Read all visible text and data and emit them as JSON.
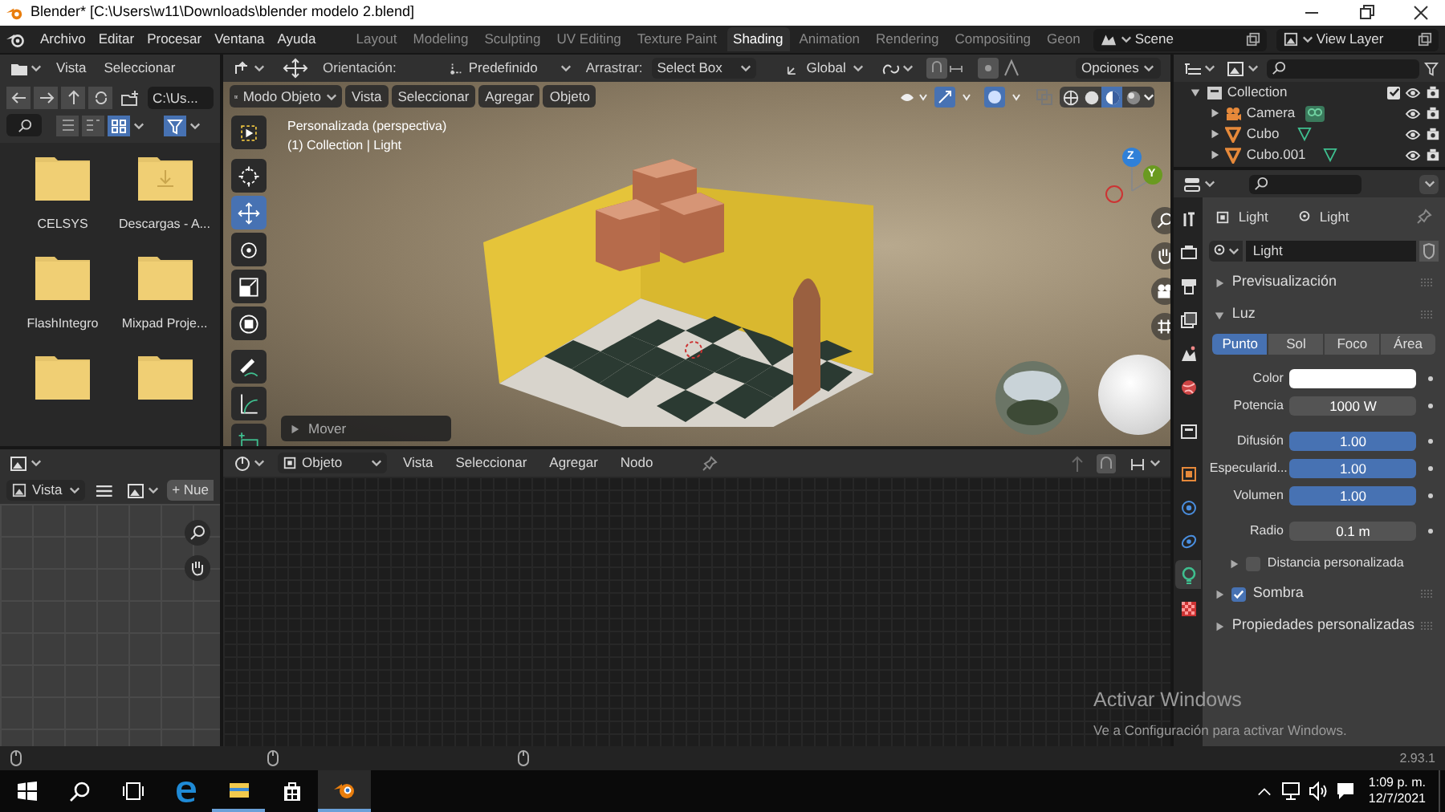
{
  "title_bar": {
    "title": "Blender* [C:\\Users\\w11\\Downloads\\blender modelo 2.blend]"
  },
  "menu": [
    "Archivo",
    "Editar",
    "Procesar",
    "Ventana",
    "Ayuda"
  ],
  "workspaces": [
    {
      "label": "Layout",
      "selected": false
    },
    {
      "label": "Modeling",
      "selected": false
    },
    {
      "label": "Sculpting",
      "selected": false
    },
    {
      "label": "UV Editing",
      "selected": false
    },
    {
      "label": "Texture Paint",
      "selected": false
    },
    {
      "label": "Shading",
      "selected": true
    },
    {
      "label": "Animation",
      "selected": false
    },
    {
      "label": "Rendering",
      "selected": false
    },
    {
      "label": "Compositing",
      "selected": false
    },
    {
      "label": "Geon",
      "selected": false
    }
  ],
  "scene": "Scene",
  "view_layer": "View Layer",
  "file_browser": {
    "menus": [
      "Vista",
      "Seleccionar"
    ],
    "path": "C:\\Us...",
    "items": [
      {
        "label": "CELSYS",
        "kind": "folder"
      },
      {
        "label": "Descargas - A...",
        "kind": "download"
      },
      {
        "label": "FlashIntegro",
        "kind": "folder"
      },
      {
        "label": "Mixpad Proje...",
        "kind": "folder"
      },
      {
        "kind": "folder"
      },
      {
        "kind": "folder"
      }
    ]
  },
  "image_editor": {
    "view_menu": "Vista",
    "new_button": "+ Nue"
  },
  "viewport": {
    "orientation_label": "Orientación:",
    "pivot": "Predefinido",
    "drag_label": "Arrastrar:",
    "drag": "Select Box",
    "transform": "Global",
    "options": "Opciones",
    "mode": "Modo Objeto",
    "menus": [
      "Vista",
      "Seleccionar",
      "Agregar",
      "Objeto"
    ],
    "view_name": "Personalizada (perspectiva)",
    "context": "(1) Collection | Light",
    "last_operator": "Mover",
    "tools": [
      {
        "kind": "select",
        "selected": false
      },
      {
        "kind": "cursor",
        "selected": false
      },
      {
        "kind": "move",
        "selected": true
      },
      {
        "kind": "rotate",
        "selected": false
      },
      {
        "kind": "scale",
        "selected": false
      },
      {
        "kind": "transform",
        "selected": false
      },
      {
        "kind": "annotate",
        "selected": false
      },
      {
        "kind": "measure",
        "selected": false
      },
      {
        "kind": "add",
        "selected": false
      }
    ],
    "shading": [
      {
        "kind": "wireframe",
        "selected": false
      },
      {
        "kind": "solid",
        "selected": false
      },
      {
        "kind": "material",
        "selected": true
      },
      {
        "kind": "rendered",
        "selected": false
      }
    ],
    "gizmo_axes": [
      "Z",
      "Y"
    ]
  },
  "node_editor": {
    "data_type": "Objeto",
    "menus": [
      "Vista",
      "Seleccionar",
      "Agregar",
      "Nodo"
    ]
  },
  "outliner": {
    "items": [
      {
        "label": "Collection",
        "kind": "collection",
        "expanded": true,
        "checked": true,
        "children": [
          {
            "label": "Camera",
            "kind": "camera",
            "expanded": false
          },
          {
            "label": "Cubo",
            "kind": "mesh",
            "expanded": false
          },
          {
            "label": "Cubo.001",
            "kind": "mesh",
            "expanded": false
          }
        ]
      }
    ]
  },
  "properties": {
    "tabs": [
      {
        "kind": "tool",
        "selected": false
      },
      {
        "kind": "render",
        "selected": false
      },
      {
        "kind": "output",
        "selected": false
      },
      {
        "kind": "view_layer",
        "selected": false
      },
      {
        "kind": "scene",
        "selected": false
      },
      {
        "kind": "world",
        "selected": false
      },
      {
        "kind": "collection",
        "selected": false
      },
      {
        "kind": "object",
        "selected": false
      },
      {
        "kind": "physics",
        "selected": false
      },
      {
        "kind": "constraints",
        "selected": false
      },
      {
        "kind": "light",
        "selected": true
      },
      {
        "kind": "texture",
        "selected": false
      }
    ],
    "object_name": "Light",
    "data_name": "Light",
    "datablock": "Light",
    "preview_panel": {
      "title": "Previsualización",
      "expanded": false
    },
    "light_panel": {
      "title": "Luz",
      "expanded": true,
      "types": [
        {
          "label": "Punto",
          "selected": true
        },
        {
          "label": "Sol",
          "selected": false
        },
        {
          "label": "Foco",
          "selected": false
        },
        {
          "label": "Área",
          "selected": false
        }
      ],
      "fields": [
        {
          "label": "Color",
          "kind": "color",
          "color": "#ffffff"
        },
        {
          "label": "Potencia",
          "kind": "number",
          "value": "1000 W"
        },
        {
          "label": "Difusión",
          "kind": "slider",
          "value": "1.00",
          "level": 1
        },
        {
          "label": "Especularid...",
          "kind": "slider",
          "value": "1.00",
          "level": 1
        },
        {
          "label": "Volumen",
          "kind": "slider",
          "value": "1.00",
          "level": 1
        },
        {
          "label": "Radio",
          "kind": "number",
          "value": "0.1 m"
        }
      ],
      "custom_distance": {
        "label": "Distancia personalizada",
        "checked": false,
        "expanded": false
      }
    },
    "shadow_panel": {
      "title": "Sombra",
      "expanded": false,
      "checked": true
    },
    "custom_props_panel": {
      "title": "Propiedades personalizadas",
      "expanded": false
    }
  },
  "watermark": {
    "title": "Activar Windows",
    "text": "Ve a Configuración para activar Windows."
  },
  "status_bar": {
    "version": "2.93.1"
  },
  "taskbar": {
    "time": "1:09 p. m.",
    "date": "12/7/2021"
  }
}
